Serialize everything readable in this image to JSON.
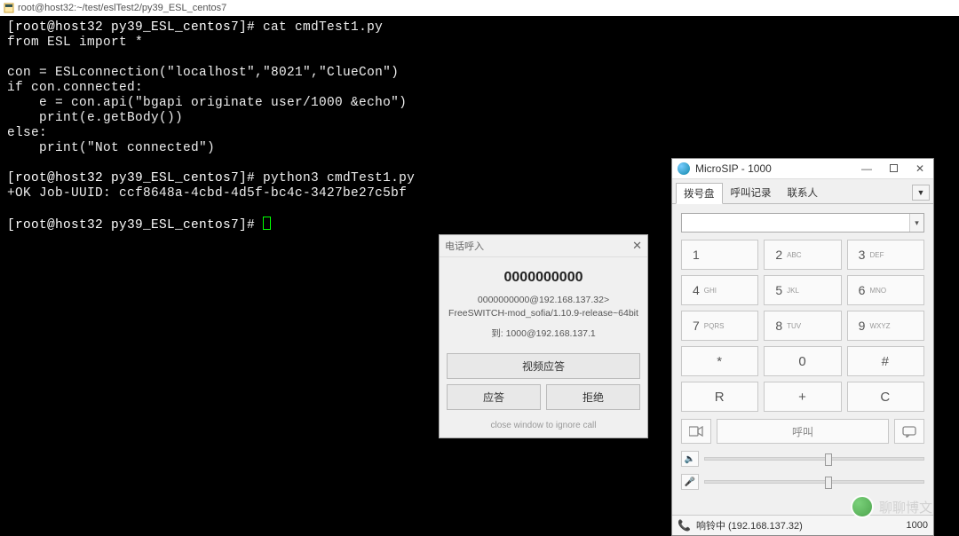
{
  "putty": {
    "title": "root@host32:~/test/eslTest2/py39_ESL_centos7"
  },
  "terminal": {
    "prompt1": "[root@host32 py39_ESL_centos7]# ",
    "cmd1": "cat cmdTest1.py",
    "code_line1": "from ESL import *",
    "code_line2": "con = ESLconnection(\"localhost\",\"8021\",\"ClueCon\")",
    "code_line3": "if con.connected:",
    "code_line4": "    e = con.api(\"bgapi originate user/1000 &echo\")",
    "code_line5": "    print(e.getBody())",
    "code_line6": "else:",
    "code_line7": "    print(\"Not connected\")",
    "prompt2": "[root@host32 py39_ESL_centos7]# ",
    "cmd2": "python3 cmdTest1.py",
    "output": "+OK Job-UUID: ccf8648a-4cbd-4d5f-bc4c-3427be27c5bf",
    "prompt3": "[root@host32 py39_ESL_centos7]# "
  },
  "call": {
    "title": "电话呼入",
    "number": "0000000000",
    "info1": "0000000000@192.168.137.32>",
    "info2": "FreeSWITCH-mod_sofia/1.10.9-release~64bit",
    "info3": "到: 1000@192.168.137.1",
    "video_btn": "视频应答",
    "answer_btn": "应答",
    "reject_btn": "拒绝",
    "footer": "close window to ignore call"
  },
  "sip": {
    "title": "MicroSIP - 1000",
    "tabs": {
      "dial": "拨号盘",
      "log": "呼叫记录",
      "contacts": "联系人"
    },
    "dialpad": [
      {
        "n": "1",
        "s": ""
      },
      {
        "n": "2",
        "s": "ABC"
      },
      {
        "n": "3",
        "s": "DEF"
      },
      {
        "n": "4",
        "s": "GHI"
      },
      {
        "n": "5",
        "s": "JKL"
      },
      {
        "n": "6",
        "s": "MNO"
      },
      {
        "n": "7",
        "s": "PQRS"
      },
      {
        "n": "8",
        "s": "TUV"
      },
      {
        "n": "9",
        "s": "WXYZ"
      },
      {
        "n": "*",
        "s": ""
      },
      {
        "n": "0",
        "s": ""
      },
      {
        "n": "#",
        "s": ""
      }
    ],
    "redial": "R",
    "plus": "+",
    "clear": "C",
    "call_btn": "呼叫",
    "status_text": "响铃中 (192.168.137.32)",
    "status_ext": "1000"
  },
  "watermark": {
    "text": "聊聊博文"
  }
}
